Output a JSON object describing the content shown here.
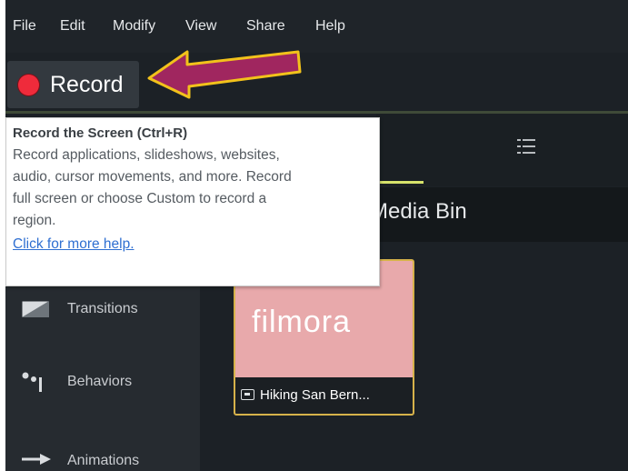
{
  "menu": {
    "items": [
      {
        "label": "File"
      },
      {
        "label": "Edit"
      },
      {
        "label": "Modify"
      },
      {
        "label": "View"
      },
      {
        "label": "Share"
      },
      {
        "label": "Help"
      }
    ]
  },
  "toolbar": {
    "record_label": "Record"
  },
  "tooltip": {
    "title": "Record the Screen (Ctrl+R)",
    "lines": [
      "Record applications, slideshows, websites,",
      "audio, cursor movements, and more. Record",
      "full screen or choose Custom to record a",
      "region."
    ],
    "link": "Click for more help."
  },
  "media_bin": {
    "title": "Media Bin"
  },
  "sidebar": {
    "items": [
      {
        "label": "Transitions",
        "icon": "transitions-icon"
      },
      {
        "label": "Behaviors",
        "icon": "behaviors-icon"
      },
      {
        "label": "Animations",
        "icon": "animations-icon"
      }
    ]
  },
  "clip": {
    "thumbnail_text": "filmora",
    "name": "Hiking San Bern..."
  },
  "colors": {
    "record_red": "#ef2b3b",
    "accent_green": "#d7e26a",
    "selection_gold": "#d6b24a",
    "arrow_magenta": "#a0265f",
    "arrow_outline": "#f2c21b",
    "link_blue": "#2f6fd1"
  }
}
